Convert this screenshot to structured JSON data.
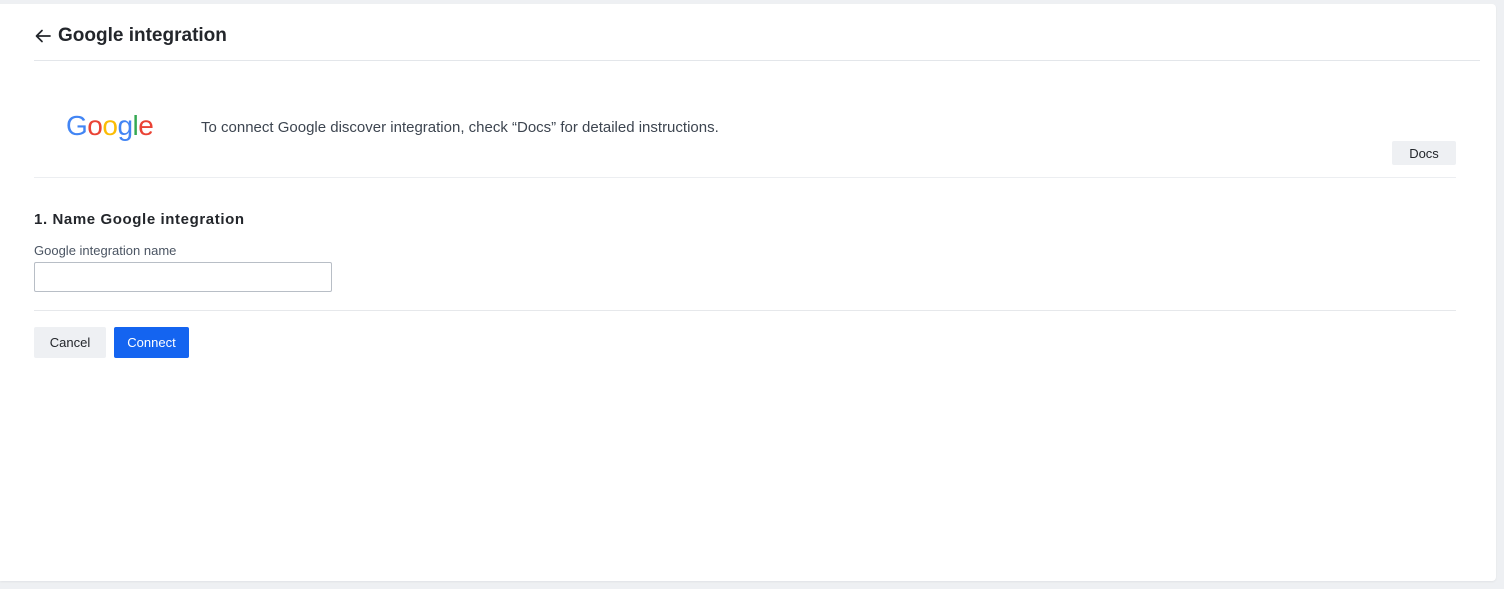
{
  "header": {
    "back_icon": "arrow-left-icon",
    "title": "Google integration"
  },
  "intro": {
    "logo": {
      "letters": [
        "G",
        "o",
        "o",
        "g",
        "l",
        "e"
      ],
      "colors": [
        "#4285F4",
        "#EA4335",
        "#FBBC05",
        "#4285F4",
        "#34A853",
        "#EA4335"
      ]
    },
    "text": "To connect Google discover integration, check “Docs” for detailed instructions.",
    "docs_label": "Docs"
  },
  "form": {
    "section_title": "1. Name Google integration",
    "name_label": "Google integration name",
    "name_value": "",
    "name_placeholder": ""
  },
  "actions": {
    "cancel_label": "Cancel",
    "connect_label": "Connect",
    "connect_color": "#1464f0"
  }
}
